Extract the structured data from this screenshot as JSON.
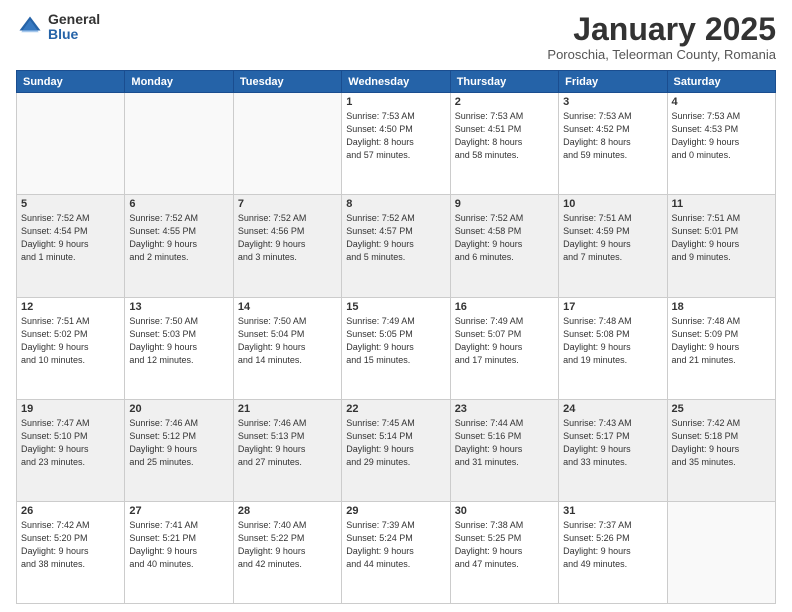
{
  "logo": {
    "general": "General",
    "blue": "Blue"
  },
  "title": "January 2025",
  "subtitle": "Poroschia, Teleorman County, Romania",
  "headers": [
    "Sunday",
    "Monday",
    "Tuesday",
    "Wednesday",
    "Thursday",
    "Friday",
    "Saturday"
  ],
  "weeks": [
    [
      {
        "day": "",
        "info": ""
      },
      {
        "day": "",
        "info": ""
      },
      {
        "day": "",
        "info": ""
      },
      {
        "day": "1",
        "info": "Sunrise: 7:53 AM\nSunset: 4:50 PM\nDaylight: 8 hours\nand 57 minutes."
      },
      {
        "day": "2",
        "info": "Sunrise: 7:53 AM\nSunset: 4:51 PM\nDaylight: 8 hours\nand 58 minutes."
      },
      {
        "day": "3",
        "info": "Sunrise: 7:53 AM\nSunset: 4:52 PM\nDaylight: 8 hours\nand 59 minutes."
      },
      {
        "day": "4",
        "info": "Sunrise: 7:53 AM\nSunset: 4:53 PM\nDaylight: 9 hours\nand 0 minutes."
      }
    ],
    [
      {
        "day": "5",
        "info": "Sunrise: 7:52 AM\nSunset: 4:54 PM\nDaylight: 9 hours\nand 1 minute."
      },
      {
        "day": "6",
        "info": "Sunrise: 7:52 AM\nSunset: 4:55 PM\nDaylight: 9 hours\nand 2 minutes."
      },
      {
        "day": "7",
        "info": "Sunrise: 7:52 AM\nSunset: 4:56 PM\nDaylight: 9 hours\nand 3 minutes."
      },
      {
        "day": "8",
        "info": "Sunrise: 7:52 AM\nSunset: 4:57 PM\nDaylight: 9 hours\nand 5 minutes."
      },
      {
        "day": "9",
        "info": "Sunrise: 7:52 AM\nSunset: 4:58 PM\nDaylight: 9 hours\nand 6 minutes."
      },
      {
        "day": "10",
        "info": "Sunrise: 7:51 AM\nSunset: 4:59 PM\nDaylight: 9 hours\nand 7 minutes."
      },
      {
        "day": "11",
        "info": "Sunrise: 7:51 AM\nSunset: 5:01 PM\nDaylight: 9 hours\nand 9 minutes."
      }
    ],
    [
      {
        "day": "12",
        "info": "Sunrise: 7:51 AM\nSunset: 5:02 PM\nDaylight: 9 hours\nand 10 minutes."
      },
      {
        "day": "13",
        "info": "Sunrise: 7:50 AM\nSunset: 5:03 PM\nDaylight: 9 hours\nand 12 minutes."
      },
      {
        "day": "14",
        "info": "Sunrise: 7:50 AM\nSunset: 5:04 PM\nDaylight: 9 hours\nand 14 minutes."
      },
      {
        "day": "15",
        "info": "Sunrise: 7:49 AM\nSunset: 5:05 PM\nDaylight: 9 hours\nand 15 minutes."
      },
      {
        "day": "16",
        "info": "Sunrise: 7:49 AM\nSunset: 5:07 PM\nDaylight: 9 hours\nand 17 minutes."
      },
      {
        "day": "17",
        "info": "Sunrise: 7:48 AM\nSunset: 5:08 PM\nDaylight: 9 hours\nand 19 minutes."
      },
      {
        "day": "18",
        "info": "Sunrise: 7:48 AM\nSunset: 5:09 PM\nDaylight: 9 hours\nand 21 minutes."
      }
    ],
    [
      {
        "day": "19",
        "info": "Sunrise: 7:47 AM\nSunset: 5:10 PM\nDaylight: 9 hours\nand 23 minutes."
      },
      {
        "day": "20",
        "info": "Sunrise: 7:46 AM\nSunset: 5:12 PM\nDaylight: 9 hours\nand 25 minutes."
      },
      {
        "day": "21",
        "info": "Sunrise: 7:46 AM\nSunset: 5:13 PM\nDaylight: 9 hours\nand 27 minutes."
      },
      {
        "day": "22",
        "info": "Sunrise: 7:45 AM\nSunset: 5:14 PM\nDaylight: 9 hours\nand 29 minutes."
      },
      {
        "day": "23",
        "info": "Sunrise: 7:44 AM\nSunset: 5:16 PM\nDaylight: 9 hours\nand 31 minutes."
      },
      {
        "day": "24",
        "info": "Sunrise: 7:43 AM\nSunset: 5:17 PM\nDaylight: 9 hours\nand 33 minutes."
      },
      {
        "day": "25",
        "info": "Sunrise: 7:42 AM\nSunset: 5:18 PM\nDaylight: 9 hours\nand 35 minutes."
      }
    ],
    [
      {
        "day": "26",
        "info": "Sunrise: 7:42 AM\nSunset: 5:20 PM\nDaylight: 9 hours\nand 38 minutes."
      },
      {
        "day": "27",
        "info": "Sunrise: 7:41 AM\nSunset: 5:21 PM\nDaylight: 9 hours\nand 40 minutes."
      },
      {
        "day": "28",
        "info": "Sunrise: 7:40 AM\nSunset: 5:22 PM\nDaylight: 9 hours\nand 42 minutes."
      },
      {
        "day": "29",
        "info": "Sunrise: 7:39 AM\nSunset: 5:24 PM\nDaylight: 9 hours\nand 44 minutes."
      },
      {
        "day": "30",
        "info": "Sunrise: 7:38 AM\nSunset: 5:25 PM\nDaylight: 9 hours\nand 47 minutes."
      },
      {
        "day": "31",
        "info": "Sunrise: 7:37 AM\nSunset: 5:26 PM\nDaylight: 9 hours\nand 49 minutes."
      },
      {
        "day": "",
        "info": ""
      }
    ]
  ]
}
